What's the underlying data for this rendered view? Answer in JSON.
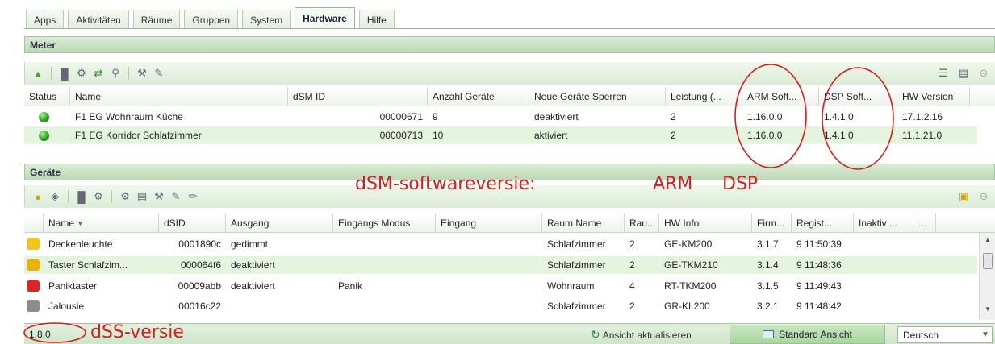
{
  "tabs": [
    {
      "label": "Apps",
      "active": false
    },
    {
      "label": "Aktivitäten",
      "active": false
    },
    {
      "label": "Räume",
      "active": false
    },
    {
      "label": "Gruppen",
      "active": false
    },
    {
      "label": "System",
      "active": false
    },
    {
      "label": "Hardware",
      "active": true
    },
    {
      "label": "Hilfe",
      "active": false
    }
  ],
  "meter": {
    "title": "Meter",
    "columns": [
      "Status",
      "Name",
      "dSM ID",
      "Anzahl Geräte",
      "Neue Geräte Sperren",
      "Leistung (...",
      "ARM Soft...",
      "DSP Soft...",
      "HW Version"
    ],
    "rows": [
      {
        "name": "F1 EG Wohnraum Küche",
        "dsm_id": "00000671",
        "devices": "9",
        "lock": "deaktiviert",
        "power": "2",
        "arm": "1.16.0.0",
        "dsp": "1.4.1.0",
        "hw": "17.1.2.16"
      },
      {
        "name": "F1 EG Korridor Schlafzimmer",
        "dsm_id": "00000713",
        "devices": "10",
        "lock": "aktiviert",
        "power": "2",
        "arm": "1.16.0.0",
        "dsp": "1.4.1.0",
        "hw": "11.1.21.0"
      }
    ]
  },
  "devices": {
    "title": "Geräte",
    "columns": [
      "Name",
      "dSID",
      "Ausgang",
      "Eingangs Modus",
      "Eingang",
      "Raum Name",
      "Rau...",
      "HW Info",
      "Firm...",
      "Regist...",
      "Inaktiv ...",
      "..."
    ],
    "rows": [
      {
        "name": "Deckenleuchte",
        "dsid": "0001890c",
        "output": "gedimmt",
        "input_mode": "",
        "input": "",
        "room": "Schlafzimmer",
        "room_no": "2",
        "hw": "GE-KM200",
        "firm": "3.1.7",
        "reg": "9 11:50:39",
        "icon_color": "#f0c419"
      },
      {
        "name": "Taster Schlafzim...",
        "dsid": "000064f6",
        "output": "deaktiviert",
        "input_mode": "",
        "input": "",
        "room": "Schlafzimmer",
        "room_no": "2",
        "hw": "GE-TKM210",
        "firm": "3.1.4",
        "reg": "9 11:48:36",
        "icon_color": "#e8b400"
      },
      {
        "name": "Paniktaster",
        "dsid": "00009abb",
        "output": "deaktiviert",
        "input_mode": "Panik",
        "input": "",
        "room": "Wohnraum",
        "room_no": "4",
        "hw": "RT-TKM200",
        "firm": "3.1.5",
        "reg": "9 11:49:43",
        "icon_color": "#d8262a"
      },
      {
        "name": "Jalousie",
        "dsid": "00016c22",
        "output": "",
        "input_mode": "",
        "input": "",
        "room": "Schlafzimmer",
        "room_no": "2",
        "hw": "GR-KL200",
        "firm": "3.2.1",
        "reg": "9 11:48:42",
        "icon_color": "#8c8c8c"
      }
    ]
  },
  "footer": {
    "version": "1.8.0",
    "refresh_label": "Ansicht aktualisieren",
    "standard_view_label": "Standard Ansicht",
    "language": "Deutsch"
  },
  "annotations": {
    "dsm_software": "dSM-softwareversie:",
    "arm": "ARM",
    "dsp": "DSP",
    "dss_version": "dSS-versie",
    "color": "#d21f1f"
  },
  "colors": {
    "header_green": "#bcd9b6",
    "row_alt": "#e5f4df",
    "status_green": "#2d9a22"
  }
}
